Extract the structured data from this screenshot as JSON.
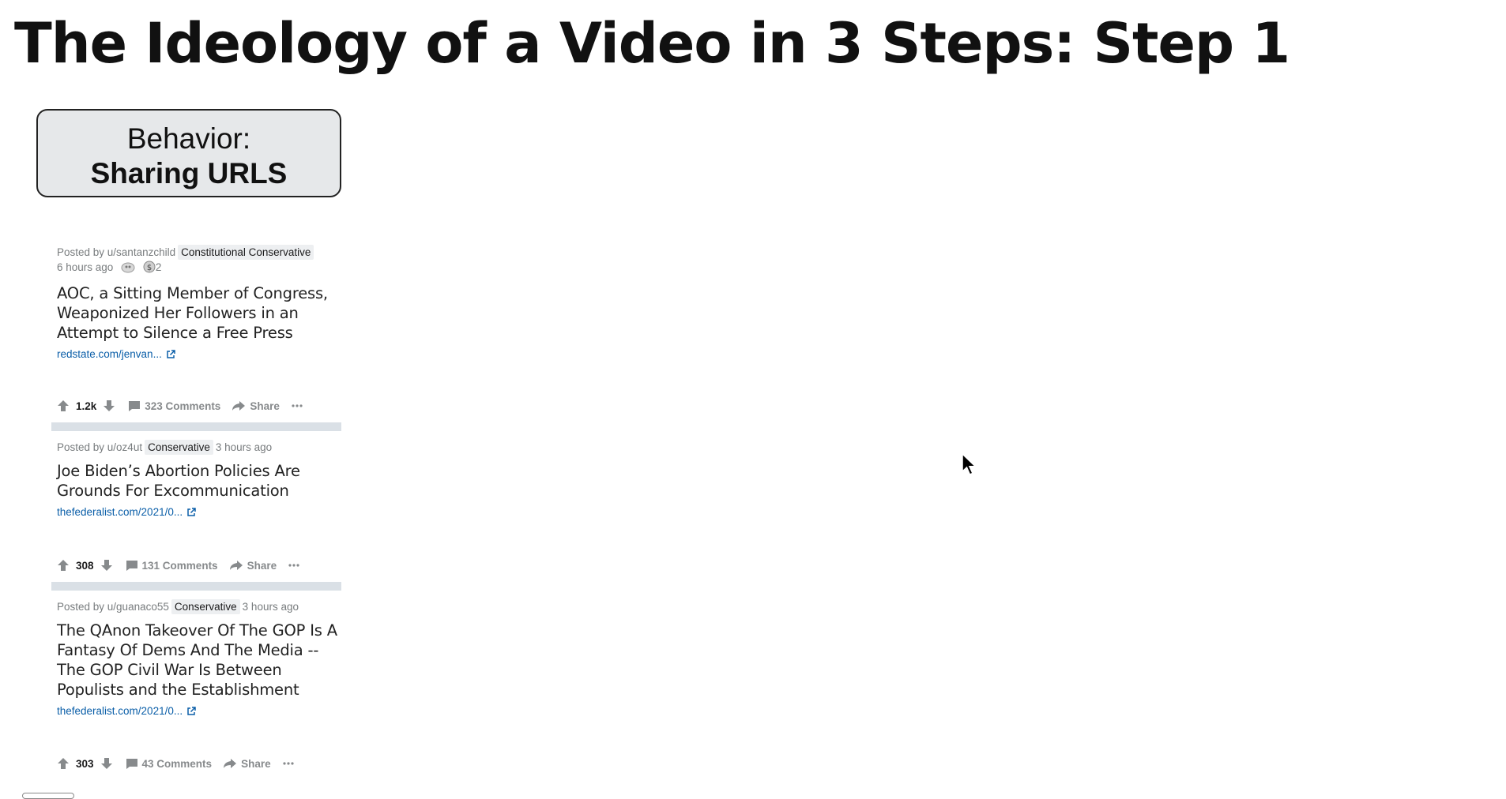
{
  "slide": {
    "title": "The Ideology of a Video in 3 Steps: Step 1",
    "behavior_label": "Behavior:",
    "behavior_value": "Sharing URLS"
  },
  "posts": [
    {
      "posted_by": "Posted by u/santanzchild",
      "flair": "Constitutional Conservative",
      "time": "6 hours ago",
      "award_count": "2",
      "title": "AOC, a Sitting Member of Congress, Weaponized Her Followers in an Attempt to Silence a Free Press",
      "link": "redstate.com/jenvan...",
      "score": "1.2k",
      "comments": "323 Comments",
      "share": "Share"
    },
    {
      "posted_by": "Posted by u/oz4ut",
      "flair": "Conservative",
      "time": "3 hours ago",
      "title": "Joe Biden’s Abortion Policies Are Grounds For Excommunication",
      "link": "thefederalist.com/2021/0...",
      "score": "308",
      "comments": "131 Comments",
      "share": "Share"
    },
    {
      "posted_by": "Posted by u/guanaco55",
      "flair": "Conservative",
      "time": "3 hours ago",
      "title": "The QAnon Takeover Of The GOP Is A Fantasy Of Dems And The Media -- The GOP Civil War Is Between Populists and the Establishment",
      "link": "thefederalist.com/2021/0...",
      "score": "303",
      "comments": "43 Comments",
      "share": "Share"
    }
  ],
  "colors": {
    "link": "#0a5ea8",
    "meta_text": "#787c7e",
    "flair_bg": "#edeff1",
    "separator": "#dae0e6",
    "behavior_box_bg": "#e6e8ea"
  },
  "icons": [
    "upvote-icon",
    "downvote-icon",
    "comment-icon",
    "share-icon",
    "more-icon",
    "external-link-icon",
    "award-icon",
    "cursor-icon"
  ]
}
